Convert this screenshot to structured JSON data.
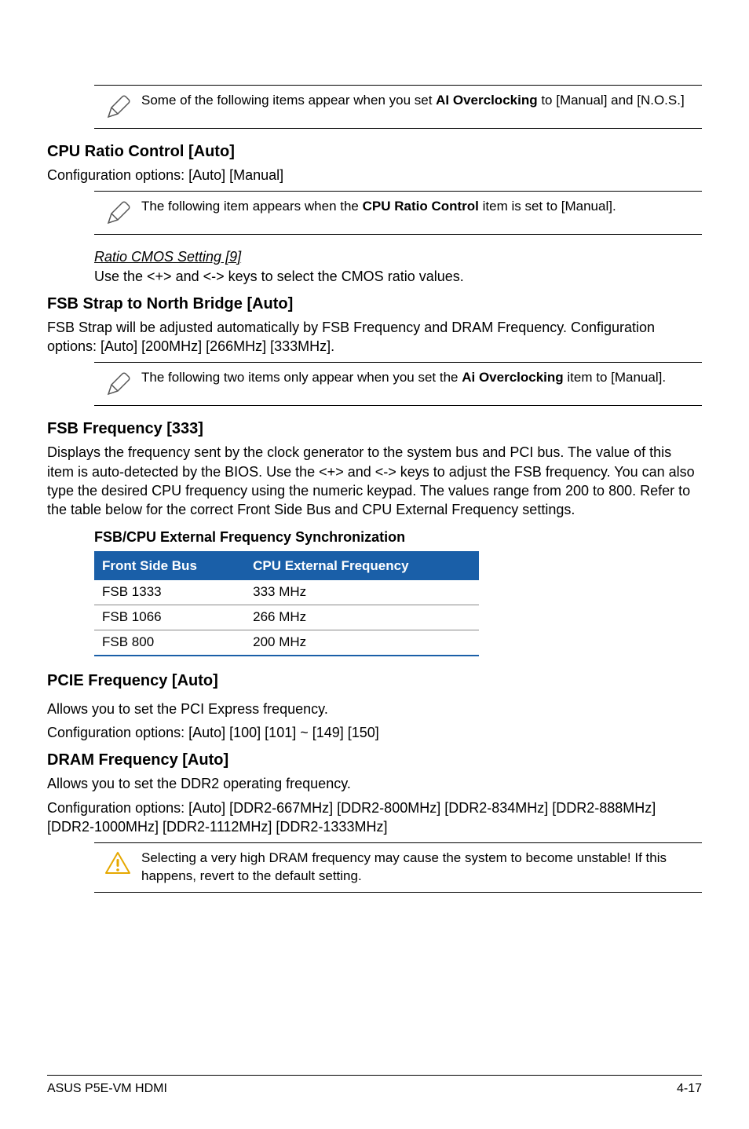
{
  "notes": {
    "n1_pre": "Some of the following items appear when you set ",
    "n1_bold": "AI Overclocking",
    "n1_post": " to [Manual] and [N.O.S.]",
    "n2_pre": "The following item appears when the ",
    "n2_bold": "CPU Ratio Control",
    "n2_post": " item is set to [Manual].",
    "n3_pre": "The following two items only appear when you set the ",
    "n3_bold": "Ai Overclocking",
    "n3_post": " item to [Manual].",
    "warn": "Selecting a very high DRAM frequency may cause the system to become unstable! If this happens, revert to the default setting."
  },
  "sections": {
    "cpu_ratio_heading": "CPU Ratio Control [Auto]",
    "cpu_ratio_body": "Configuration options: [Auto] [Manual]",
    "ratio_cmos_heading": "Ratio CMOS Setting [9]",
    "ratio_cmos_body": "Use the <+> and <-> keys to select the CMOS ratio values.",
    "fsb_strap_heading": "FSB Strap to North Bridge [Auto]",
    "fsb_strap_body": "FSB Strap will be adjusted automatically by FSB Frequency and DRAM Frequency. Configuration options: [Auto] [200MHz] [266MHz] [333MHz].",
    "fsb_freq_heading": "FSB Frequency [333]",
    "fsb_freq_body": "Displays the frequency sent by the clock generator to the system bus and PCI bus. The value of this item is auto-detected by the BIOS. Use the <+> and <-> keys to adjust the FSB frequency. You can also type the desired CPU frequency using the numeric keypad. The values range from 200 to 800. Refer to the table below for the correct Front Side Bus and CPU External Frequency settings.",
    "table_caption": "FSB/CPU External Frequency Synchronization",
    "pcie_heading": "PCIE Frequency [Auto]",
    "pcie_body1": "Allows you to set the PCI Express frequency.",
    "pcie_body2": "Configuration options: [Auto] [100] [101] ~ [149] [150]",
    "dram_heading": "DRAM Frequency [Auto]",
    "dram_body1": "Allows you to set the DDR2 operating frequency.",
    "dram_body2": "Configuration options: [Auto] [DDR2-667MHz] [DDR2-800MHz] [DDR2-834MHz] [DDR2-888MHz] [DDR2-1000MHz] [DDR2-1112MHz] [DDR2-1333MHz]"
  },
  "chart_data": {
    "type": "table",
    "headers": [
      "Front Side Bus",
      "CPU External Frequency"
    ],
    "rows": [
      [
        "FSB 1333",
        "333 MHz"
      ],
      [
        "FSB 1066",
        "266 MHz"
      ],
      [
        "FSB 800",
        "200 MHz"
      ]
    ]
  },
  "footer": {
    "left": "ASUS P5E-VM HDMI",
    "right": "4-17"
  }
}
